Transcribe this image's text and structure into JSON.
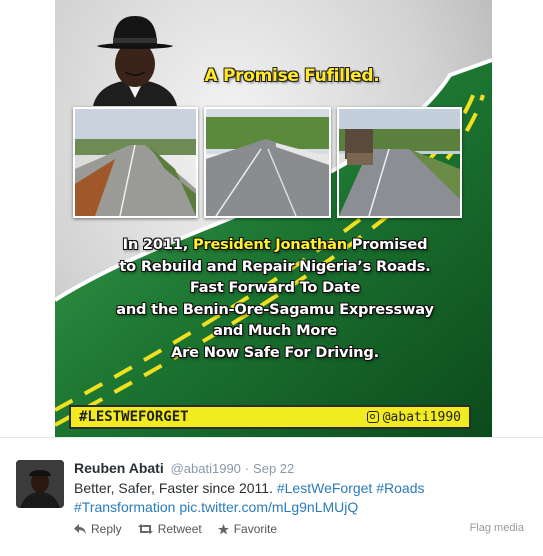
{
  "poster": {
    "headline": "A Promise Fufilled.",
    "body_lines": [
      {
        "pre": "In 2011, ",
        "highlight": "President Jonathan",
        "post": " Promised"
      },
      {
        "pre": "to Rebuild and Repair Nigeria’s Roads.",
        "highlight": "",
        "post": ""
      },
      {
        "pre": "Fast Forward To Date",
        "highlight": "",
        "post": ""
      },
      {
        "pre": "and the Benin-Ore-Sagamu Expressway",
        "highlight": "",
        "post": ""
      },
      {
        "pre": "and Much More",
        "highlight": "",
        "post": ""
      },
      {
        "pre": "Are Now Safe For Driving.",
        "highlight": "",
        "post": ""
      }
    ],
    "hashtag": "#LESTWEFORGET",
    "handle": "@abati1990",
    "colors": {
      "accent_yellow": "#f1eb1f",
      "green": "#1d7a34"
    }
  },
  "tweet": {
    "name": "Reuben Abati",
    "handle": "@abati1990",
    "separator": "·",
    "date": "Sep 22",
    "text_plain": "Better, Safer, Faster since 2011. ",
    "hashtag1": "#LestWeForget",
    "hashtag2": "#Roads",
    "hashtag3": "#Transformation",
    "media_link": "pic.twitter.com/mLg9nLMUjQ",
    "actions": {
      "reply": "Reply",
      "retweet": "Retweet",
      "favorite": "Favorite"
    },
    "flag_media": "Flag media",
    "colors": {
      "link": "#2b7bb9",
      "muted": "#8899a6",
      "text": "#292f33"
    }
  }
}
